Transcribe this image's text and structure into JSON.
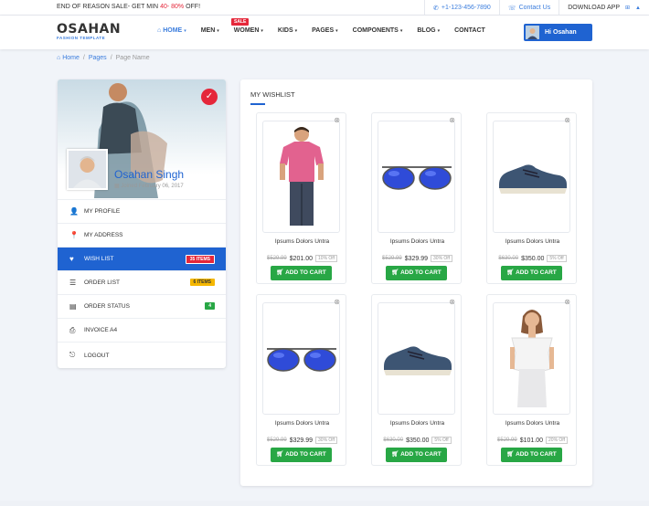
{
  "topbar": {
    "promo_prefix": "END OF REASON SALE- GET MIN ",
    "promo_highlight": "40- 80%",
    "promo_suffix": " OFF!",
    "phone": "+1-123-456-7890",
    "contact": "Contact Us",
    "download": "DOWNLOAD APP"
  },
  "logo": {
    "name": "OSAHAN",
    "tagline": "FASHION TEMPLATE"
  },
  "menu": [
    {
      "label": "HOME",
      "caret": "▾"
    },
    {
      "label": "MEN",
      "caret": "▾"
    },
    {
      "label": "WOMEN",
      "caret": "▾"
    },
    {
      "label": "KIDS",
      "caret": "▾"
    },
    {
      "label": "PAGES",
      "caret": "▾"
    },
    {
      "label": "COMPONENTS",
      "caret": "▾"
    },
    {
      "label": "BLOG",
      "caret": "▾"
    },
    {
      "label": "CONTACT",
      "caret": ""
    }
  ],
  "sale_badge": "SALE",
  "user_button": "Hi Osahan",
  "breadcrumb": [
    "Home",
    "/",
    "Pages",
    "/",
    "Page Name"
  ],
  "profile": {
    "name": "Osahan Singh",
    "joined": "Joined February 06, 2017"
  },
  "side_menu": [
    {
      "label": "MY PROFILE",
      "icon": "👤",
      "badge": ""
    },
    {
      "label": "MY ADDRESS",
      "icon": "📍",
      "badge": ""
    },
    {
      "label": "WISH LIST",
      "icon": "♥",
      "badge": "35 ITEMS"
    },
    {
      "label": "ORDER LIST",
      "icon": "☰",
      "badge": "6 ITEMS"
    },
    {
      "label": "ORDER STATUS",
      "icon": "▤",
      "badge": "4"
    },
    {
      "label": "INVOICE A4",
      "icon": "⎙",
      "badge": ""
    },
    {
      "label": "LOGOUT",
      "icon": "⎋",
      "badge": ""
    }
  ],
  "wishlist_title": "MY WISHLIST",
  "products": [
    {
      "name": "Ipsums Dolors Untra",
      "old": "$529.99",
      "price": "$201.00",
      "off": "10% Off",
      "cart": "ADD TO CART",
      "kind": "tshirt"
    },
    {
      "name": "Ipsums Dolors Untra",
      "old": "$529.99",
      "price": "$329.99",
      "off": "30% Off",
      "cart": "ADD TO CART",
      "kind": "sunglasses"
    },
    {
      "name": "Ipsums Dolors Untra",
      "old": "$630.00",
      "price": "$350.00",
      "off": "5% Off",
      "cart": "ADD TO CART",
      "kind": "shoe"
    },
    {
      "name": "Ipsums Dolors Untra",
      "old": "$529.99",
      "price": "$329.99",
      "off": "30% Off",
      "cart": "ADD TO CART",
      "kind": "sunglasses"
    },
    {
      "name": "Ipsums Dolors Untra",
      "old": "$630.00",
      "price": "$350.00",
      "off": "5% Off",
      "cart": "ADD TO CART",
      "kind": "shoe"
    },
    {
      "name": "Ipsums Dolors Untra",
      "old": "$529.99",
      "price": "$101.00",
      "off": "20% Off",
      "cart": "ADD TO CART",
      "kind": "dress"
    }
  ],
  "colors": {
    "primary": "#1f63d1",
    "sale": "#e5273a",
    "cart": "#28a745"
  }
}
